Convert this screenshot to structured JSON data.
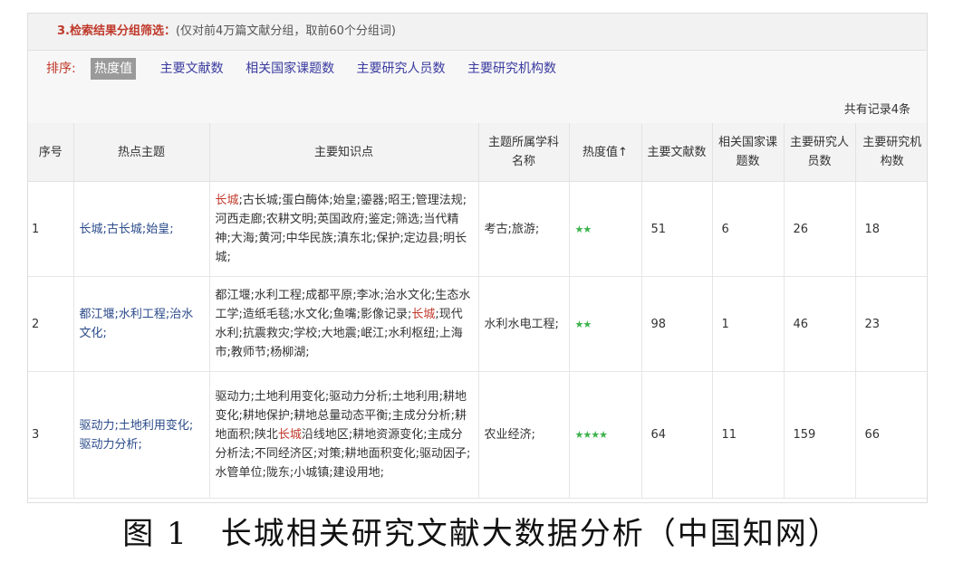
{
  "section": {
    "title": "3.检索结果分组筛选：",
    "note": "(仅对前4万篇文献分组，取前60个分组词)"
  },
  "sort": {
    "label": "排序:",
    "options": [
      "热度值",
      "主要文献数",
      "相关国家课题数",
      "主要研究人员数",
      "主要研究机构数"
    ],
    "active_index": 0
  },
  "record_count": "共有记录4条",
  "table": {
    "headers": [
      "序号",
      "热点主题",
      "主要知识点",
      "主题所属学科名称",
      "热度值↑",
      "主要文献数",
      "相关国家课题数",
      "主要研究人员数",
      "主要研究机构数"
    ],
    "rows": [
      {
        "index": "1",
        "topic": "长城;古长城;始皇;",
        "knowledge_highlight": "长城",
        "knowledge_rest": ";古长城;蛋白酶体;始皇;鎏器;昭王;管理法规;河西走廊;农耕文明;英国政府;鉴定;筛选;当代精神;大海;黄河;中华民族;滇东北;保护;定边县;明长城;",
        "subject": "考古;旅游;",
        "stars": 2,
        "docs": "51",
        "projects": "6",
        "researchers": "26",
        "institutions": "18"
      },
      {
        "index": "2",
        "topic": "都江堰;水利工程;治水文化;",
        "knowledge_before": "都江堰;水利工程;成都平原;李冰;治水文化;生态水工学;造纸毛毯;水文化;鱼嘴;影像记录;",
        "knowledge_highlight": "长城",
        "knowledge_after": ";现代水利;抗震救灾;学校;大地震;岷江;水利枢纽;上海市;教师节;杨柳湖;",
        "subject": "水利水电工程;",
        "stars": 2,
        "docs": "98",
        "projects": "1",
        "researchers": "46",
        "institutions": "23"
      },
      {
        "index": "3",
        "topic": "驱动力;土地利用变化;驱动力分析;",
        "knowledge_before": "驱动力;土地利用变化;驱动力分析;土地利用;耕地变化;耕地保护;耕地总量动态平衡;主成分分析;耕地面积;陕北",
        "knowledge_highlight": "长城",
        "knowledge_after": "沿线地区;耕地资源变化;主成分分析法;不同经济区;对策;耕地面积变化;驱动因子;水管单位;陇东;小城镇;建设用地;",
        "subject": "农业经济;",
        "stars": 4,
        "docs": "64",
        "projects": "11",
        "researchers": "159",
        "institutions": "66"
      }
    ]
  },
  "colors": {
    "accent_red": "#c0392b",
    "link_blue": "#3a3aa0",
    "star_green": "#3bb34a"
  },
  "caption": "图 1　长城相关研究文献大数据分析（中国知网）"
}
